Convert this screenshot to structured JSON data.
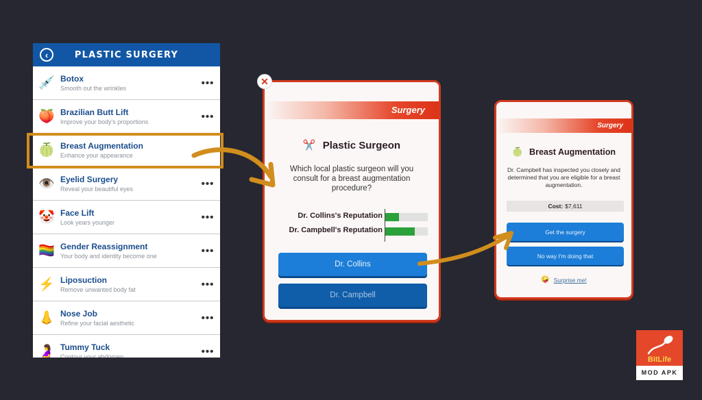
{
  "phone": {
    "title": "PLASTIC SURGERY",
    "back_icon": "chevron-left",
    "more_label": "•••",
    "items": [
      {
        "emoji": "💉",
        "icon": "syringe-icon",
        "name": "Botox",
        "desc": "Smooth out the wrinkles"
      },
      {
        "emoji": "🍑",
        "icon": "peach-icon",
        "name": "Brazilian Butt Lift",
        "desc": "Improve your body's proportions"
      },
      {
        "emoji": "🍈",
        "icon": "melon-icon",
        "name": "Breast Augmentation",
        "desc": "Enhance your appearance"
      },
      {
        "emoji": "👁️",
        "icon": "eye-icon",
        "name": "Eyelid Surgery",
        "desc": "Reveal your beautiful eyes"
      },
      {
        "emoji": "🤡",
        "icon": "clown-face-icon",
        "name": "Face Lift",
        "desc": "Look years younger"
      },
      {
        "emoji": "🏳️‍🌈",
        "icon": "rainbow-flag-icon",
        "name": "Gender Reassignment",
        "desc": "Your body and identity become one"
      },
      {
        "emoji": "⚡",
        "icon": "lightning-icon",
        "name": "Liposuction",
        "desc": "Remove unwanted body fat"
      },
      {
        "emoji": "👃",
        "icon": "nose-icon",
        "name": "Nose Job",
        "desc": "Refine your facial aesthetic"
      },
      {
        "emoji": "🤰",
        "icon": "pregnant-woman-icon",
        "name": "Tummy Tuck",
        "desc": "Contour your abdomen"
      }
    ]
  },
  "surgeon_popup": {
    "close_label": "✕",
    "banner": "Surgery",
    "title_emoji": "✂️",
    "title": "Plastic Surgeon",
    "question": "Which local plastic surgeon will you consult for a breast augmentation procedure?",
    "reputations": [
      {
        "label": "Dr. Collins's Reputation",
        "value": 0.33
      },
      {
        "label": "Dr. Campbell's Reputation",
        "value": 0.7
      }
    ],
    "buttons": [
      "Dr. Collins",
      "Dr. Campbell"
    ]
  },
  "result_popup": {
    "banner": "Surgery",
    "title_emoji": "🍈",
    "title": "Breast Augmentation",
    "message": "Dr. Campbell has inspected you closely and determined that you are eligible for a breast augmentation.",
    "cost_label": "Cost:",
    "cost_value": "$7,611",
    "buttons": [
      "Get the surgery",
      "No way I'm doing that"
    ],
    "surprise_emoji": "🤪",
    "surprise_label": "Surprise me!"
  },
  "logo": {
    "brand": "BitLife",
    "sub": "MOD APK"
  },
  "colors": {
    "header_blue": "#1257a6",
    "highlight_orange": "#d18d1d",
    "popup_red": "#d23a1e",
    "button_blue": "#1c7ed8",
    "bar_green": "#2ba13b"
  }
}
